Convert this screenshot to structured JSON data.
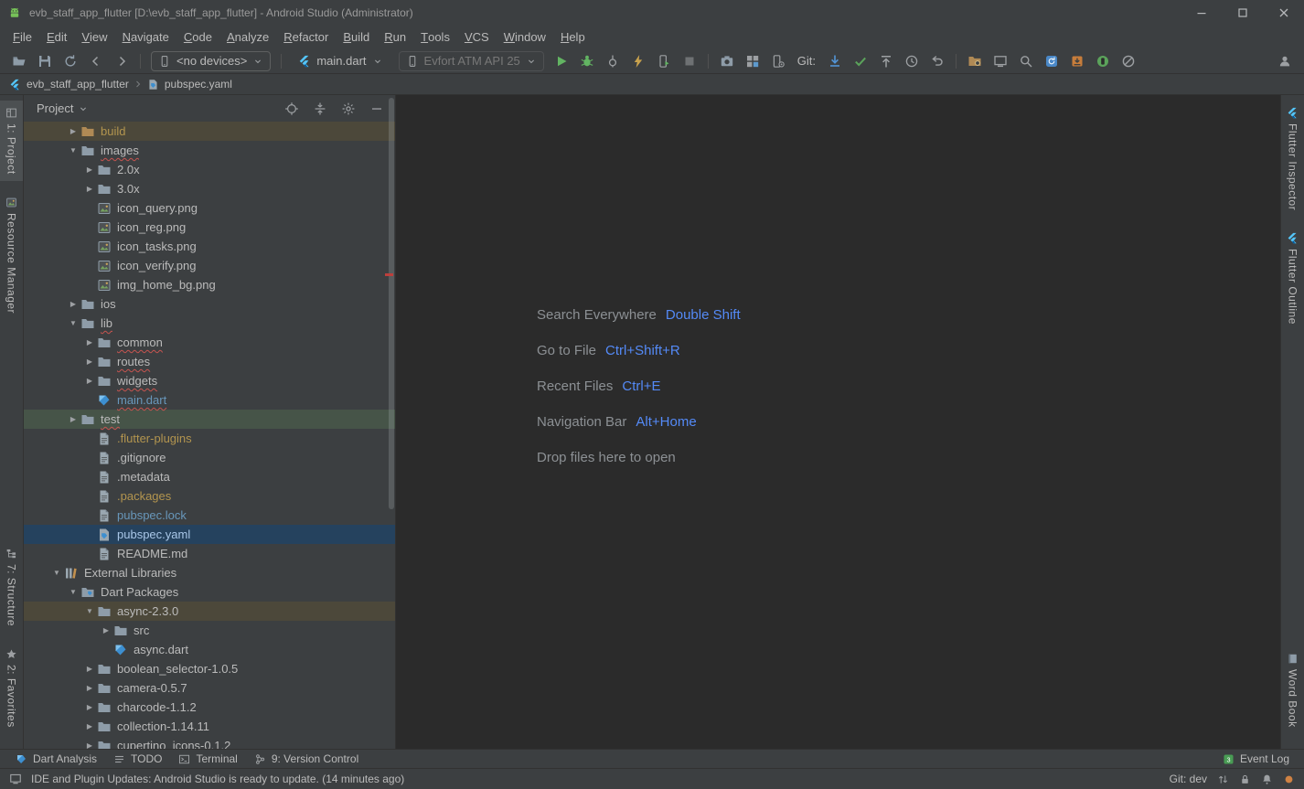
{
  "titlebar": {
    "title": "evb_staff_app_flutter [D:\\evb_staff_app_flutter] - Android Studio (Administrator)"
  },
  "menubar": [
    "File",
    "Edit",
    "View",
    "Navigate",
    "Code",
    "Analyze",
    "Refactor",
    "Build",
    "Run",
    "Tools",
    "VCS",
    "Window",
    "Help"
  ],
  "toolbar": {
    "items": [
      {
        "kind": "icon",
        "name": "open-file-button",
        "icon": "open"
      },
      {
        "kind": "icon",
        "name": "save-all-button",
        "icon": "save"
      },
      {
        "kind": "icon",
        "name": "sync-button",
        "icon": "sync"
      },
      {
        "kind": "icon",
        "name": "back-button",
        "icon": "arrow-left"
      },
      {
        "kind": "icon",
        "name": "forward-button",
        "icon": "arrow-right"
      },
      {
        "kind": "sep"
      },
      {
        "kind": "combo",
        "name": "device-selector",
        "icon": "phone",
        "label": "<no devices>",
        "boxed": true
      },
      {
        "kind": "sep"
      },
      {
        "kind": "combo",
        "name": "run-config-selector",
        "icon": "flutter",
        "label": "main.dart",
        "boxed": false
      },
      {
        "kind": "combo",
        "name": "target-device-selector",
        "icon": "phone",
        "label": "Evfort ATM API 25",
        "boxed": true,
        "disabled": true
      },
      {
        "kind": "icon",
        "name": "run-button",
        "icon": "play"
      },
      {
        "kind": "icon",
        "name": "debug-button",
        "icon": "bug"
      },
      {
        "kind": "icon",
        "name": "attach-debugger-button",
        "icon": "attach"
      },
      {
        "kind": "icon",
        "name": "profile-button",
        "icon": "bolt"
      },
      {
        "kind": "icon",
        "name": "run-profiler-button",
        "icon": "phone-play"
      },
      {
        "kind": "icon",
        "name": "stop-button",
        "icon": "stop"
      },
      {
        "kind": "sep"
      },
      {
        "kind": "icon",
        "name": "screenshot-button",
        "icon": "camera"
      },
      {
        "kind": "icon",
        "name": "layout-inspector-button",
        "icon": "grid"
      },
      {
        "kind": "icon",
        "name": "device-manager-button",
        "icon": "phone-gear"
      },
      {
        "kind": "label",
        "name": "git-label",
        "label": "Git:"
      },
      {
        "kind": "icon",
        "name": "update-project-button",
        "icon": "download-blue"
      },
      {
        "kind": "icon",
        "name": "commit-button",
        "icon": "check"
      },
      {
        "kind": "icon",
        "name": "push-button",
        "icon": "push"
      },
      {
        "kind": "icon",
        "name": "history-button",
        "icon": "clock"
      },
      {
        "kind": "icon",
        "name": "rollback-button",
        "icon": "undo"
      },
      {
        "kind": "sep"
      },
      {
        "kind": "icon",
        "name": "project-structure-button",
        "icon": "folder-gear"
      },
      {
        "kind": "icon",
        "name": "layout-editor-button",
        "icon": "monitor"
      },
      {
        "kind": "icon",
        "name": "search-everywhere-button",
        "icon": "magnifier"
      },
      {
        "kind": "icon",
        "name": "gradle-sync-button",
        "icon": "gradle"
      },
      {
        "kind": "icon",
        "name": "sdk-manager-button",
        "icon": "sdk"
      },
      {
        "kind": "icon",
        "name": "avd-manager-button",
        "icon": "avd"
      },
      {
        "kind": "icon",
        "name": "inspections-off-button",
        "icon": "slash"
      },
      {
        "kind": "spacer"
      },
      {
        "kind": "icon",
        "name": "profile-avatar-button",
        "icon": "person"
      }
    ]
  },
  "breadcrumbs": {
    "items": [
      {
        "label": "evb_staff_app_flutter",
        "icon": "flutter"
      },
      {
        "label": "pubspec.yaml",
        "icon": "pubspec"
      }
    ]
  },
  "left_stripe": {
    "top": [
      {
        "label": "1: Project",
        "icon": "project",
        "active": true
      },
      {
        "label": "Resource Manager",
        "icon": "resource"
      }
    ],
    "bottom": [
      {
        "label": "7: Structure",
        "icon": "structure"
      },
      {
        "label": "2: Favorites",
        "icon": "star"
      }
    ]
  },
  "right_stripe": {
    "top": [
      {
        "label": "Flutter Inspector",
        "icon": "flutter"
      },
      {
        "label": "Flutter Outline",
        "icon": "flutter"
      }
    ],
    "bottom": [
      {
        "label": "Word Book",
        "icon": "book"
      }
    ]
  },
  "project_panel": {
    "title": "Project",
    "tree": [
      {
        "label": "build",
        "depth": 1,
        "icon": "folder-excluded",
        "expand": "closed",
        "color": "excluded",
        "bg": "excluded"
      },
      {
        "label": "images",
        "depth": 1,
        "icon": "folder",
        "expand": "open",
        "error": true
      },
      {
        "label": "2.0x",
        "depth": 2,
        "icon": "folder",
        "expand": "closed"
      },
      {
        "label": "3.0x",
        "depth": 2,
        "icon": "folder",
        "expand": "closed"
      },
      {
        "label": "icon_query.png",
        "depth": 2,
        "icon": "image"
      },
      {
        "label": "icon_reg.png",
        "depth": 2,
        "icon": "image"
      },
      {
        "label": "icon_tasks.png",
        "depth": 2,
        "icon": "image"
      },
      {
        "label": "icon_verify.png",
        "depth": 2,
        "icon": "image"
      },
      {
        "label": "img_home_bg.png",
        "depth": 2,
        "icon": "image"
      },
      {
        "label": "ios",
        "depth": 1,
        "icon": "folder",
        "expand": "closed"
      },
      {
        "label": "lib",
        "depth": 1,
        "icon": "folder",
        "expand": "open",
        "error": true
      },
      {
        "label": "common",
        "depth": 2,
        "icon": "folder",
        "expand": "closed",
        "error": true
      },
      {
        "label": "routes",
        "depth": 2,
        "icon": "folder",
        "expand": "closed",
        "error": true
      },
      {
        "label": "widgets",
        "depth": 2,
        "icon": "folder",
        "expand": "closed",
        "error": true
      },
      {
        "label": "main.dart",
        "depth": 2,
        "icon": "dart",
        "color": "modified",
        "error": true
      },
      {
        "label": "test",
        "depth": 1,
        "icon": "folder",
        "expand": "closed",
        "bg": "test",
        "error": true
      },
      {
        "label": ".flutter-plugins",
        "depth": 2,
        "icon": "page",
        "color": "ignored"
      },
      {
        "label": ".gitignore",
        "depth": 2,
        "icon": "page"
      },
      {
        "label": ".metadata",
        "depth": 2,
        "icon": "page"
      },
      {
        "label": ".packages",
        "depth": 2,
        "icon": "page",
        "color": "ignored"
      },
      {
        "label": "pubspec.lock",
        "depth": 2,
        "icon": "page",
        "color": "modified"
      },
      {
        "label": "pubspec.yaml",
        "depth": 2,
        "icon": "pubspec",
        "bg": "selected",
        "color": "selected"
      },
      {
        "label": "README.md",
        "depth": 2,
        "icon": "page"
      },
      {
        "label": "External Libraries",
        "depth": 0,
        "icon": "libraries",
        "expand": "open"
      },
      {
        "label": "Dart Packages",
        "depth": 1,
        "icon": "packages",
        "expand": "open"
      },
      {
        "label": "async-2.3.0",
        "depth": 2,
        "icon": "folder",
        "expand": "open",
        "bg": "excluded"
      },
      {
        "label": "src",
        "depth": 3,
        "icon": "folder",
        "expand": "closed"
      },
      {
        "label": "async.dart",
        "depth": 3,
        "icon": "dart"
      },
      {
        "label": "boolean_selector-1.0.5",
        "depth": 2,
        "icon": "folder",
        "expand": "closed"
      },
      {
        "label": "camera-0.5.7",
        "depth": 2,
        "icon": "folder",
        "expand": "closed"
      },
      {
        "label": "charcode-1.1.2",
        "depth": 2,
        "icon": "folder",
        "expand": "closed"
      },
      {
        "label": "collection-1.14.11",
        "depth": 2,
        "icon": "folder",
        "expand": "closed"
      },
      {
        "label": "cupertino_icons-0.1.2",
        "depth": 2,
        "icon": "folder",
        "expand": "closed"
      }
    ]
  },
  "editor": {
    "hints": [
      {
        "label": "Search Everywhere",
        "keys": "Double Shift"
      },
      {
        "label": "Go to File",
        "keys": "Ctrl+Shift+R"
      },
      {
        "label": "Recent Files",
        "keys": "Ctrl+E"
      },
      {
        "label": "Navigation Bar",
        "keys": "Alt+Home"
      },
      {
        "label": "Drop files here to open",
        "keys": ""
      }
    ]
  },
  "bottom_bar": {
    "items": [
      {
        "label": "Dart Analysis",
        "icon": "dart-small"
      },
      {
        "label": "TODO",
        "icon": "list"
      },
      {
        "label": "Terminal",
        "icon": "terminal"
      },
      {
        "label": "9: Version Control",
        "icon": "branch"
      }
    ],
    "event_log": {
      "label": "Event Log",
      "badge": "3"
    }
  },
  "status_bar": {
    "message": "IDE and Plugin Updates: Android Studio is ready to update. (14 minutes ago)",
    "git": "Git: dev"
  },
  "colors": {
    "panel_bg": "#3C3F41",
    "editor_bg": "#2B2B2B",
    "border": "#323232",
    "text": "#BBBBBB",
    "selection_bg": "#25425E",
    "excluded_bg": "#4C483A",
    "test_bg": "#465448",
    "link_blue": "#548AF7",
    "modified_blue": "#6897BB",
    "ignored_gold": "#B3954F",
    "selected_text": "#A9C7E8",
    "hint_text": "#8C9094",
    "error_red": "#C75450"
  }
}
